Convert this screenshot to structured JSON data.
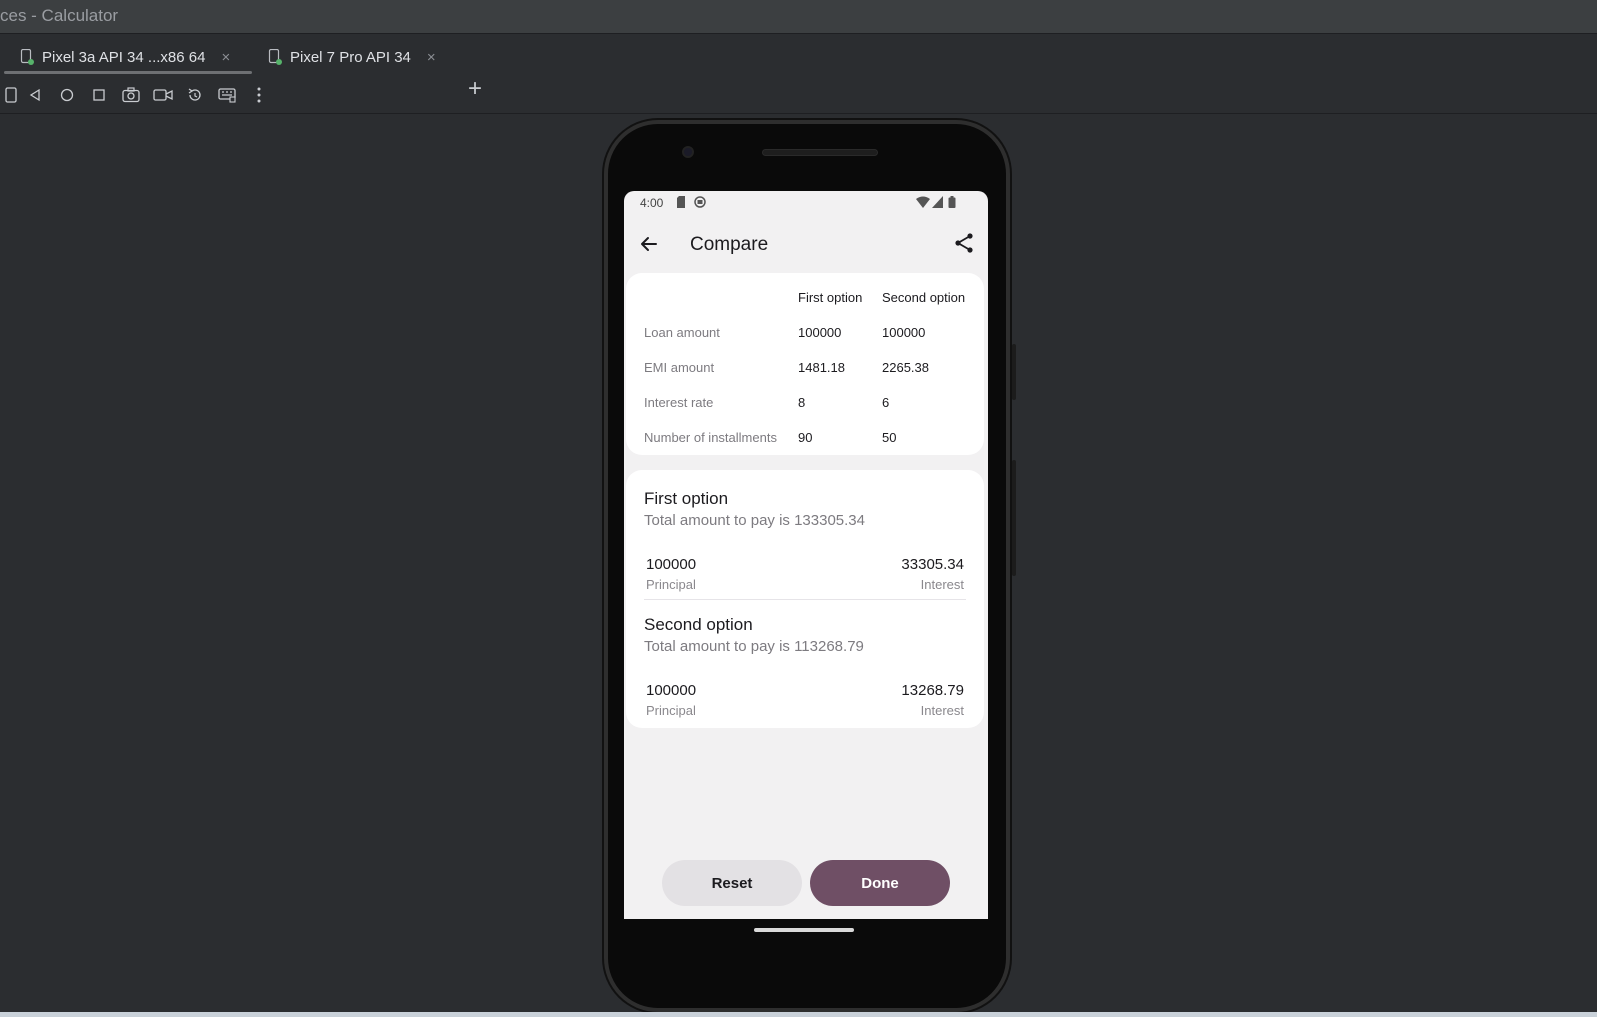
{
  "window": {
    "title": "ces - Calculator"
  },
  "tabs": [
    {
      "label": "Pixel 3a API 34 ...x86 64",
      "close": "×"
    },
    {
      "label": "Pixel 7 Pro API 34",
      "close": "×"
    }
  ],
  "add_tab": "+",
  "toolbar_icons": [
    "device-frame-icon",
    "back-icon",
    "home-icon",
    "overview-icon",
    "screenshot-icon",
    "screen-record-icon",
    "rotate-icon",
    "keyboard-icon",
    "more-icon"
  ],
  "status_bar": {
    "time": "4:00"
  },
  "app_bar": {
    "title": "Compare"
  },
  "comparison": {
    "headers": [
      "First option",
      "Second option"
    ],
    "rows": [
      {
        "label": "Loan amount",
        "first": "100000",
        "second": "100000"
      },
      {
        "label": "EMI amount",
        "first": "1481.18",
        "second": "2265.38"
      },
      {
        "label": "Interest rate",
        "first": "8",
        "second": "6"
      },
      {
        "label": "Number of installments",
        "first": "90",
        "second": "50"
      }
    ]
  },
  "options": [
    {
      "title": "First option",
      "total": "Total amount to pay is 133305.34",
      "principal": "100000",
      "principal_label": "Principal",
      "interest": "33305.34",
      "interest_label": "Interest"
    },
    {
      "title": "Second option",
      "total": "Total amount to pay is 113268.79",
      "principal": "100000",
      "principal_label": "Principal",
      "interest": "13268.79",
      "interest_label": "Interest"
    }
  ],
  "buttons": {
    "reset": "Reset",
    "done": "Done"
  },
  "colors": {
    "accent": "#6f4f65",
    "ide_background": "#2b2d30",
    "screen_background": "#f2f1f2"
  }
}
